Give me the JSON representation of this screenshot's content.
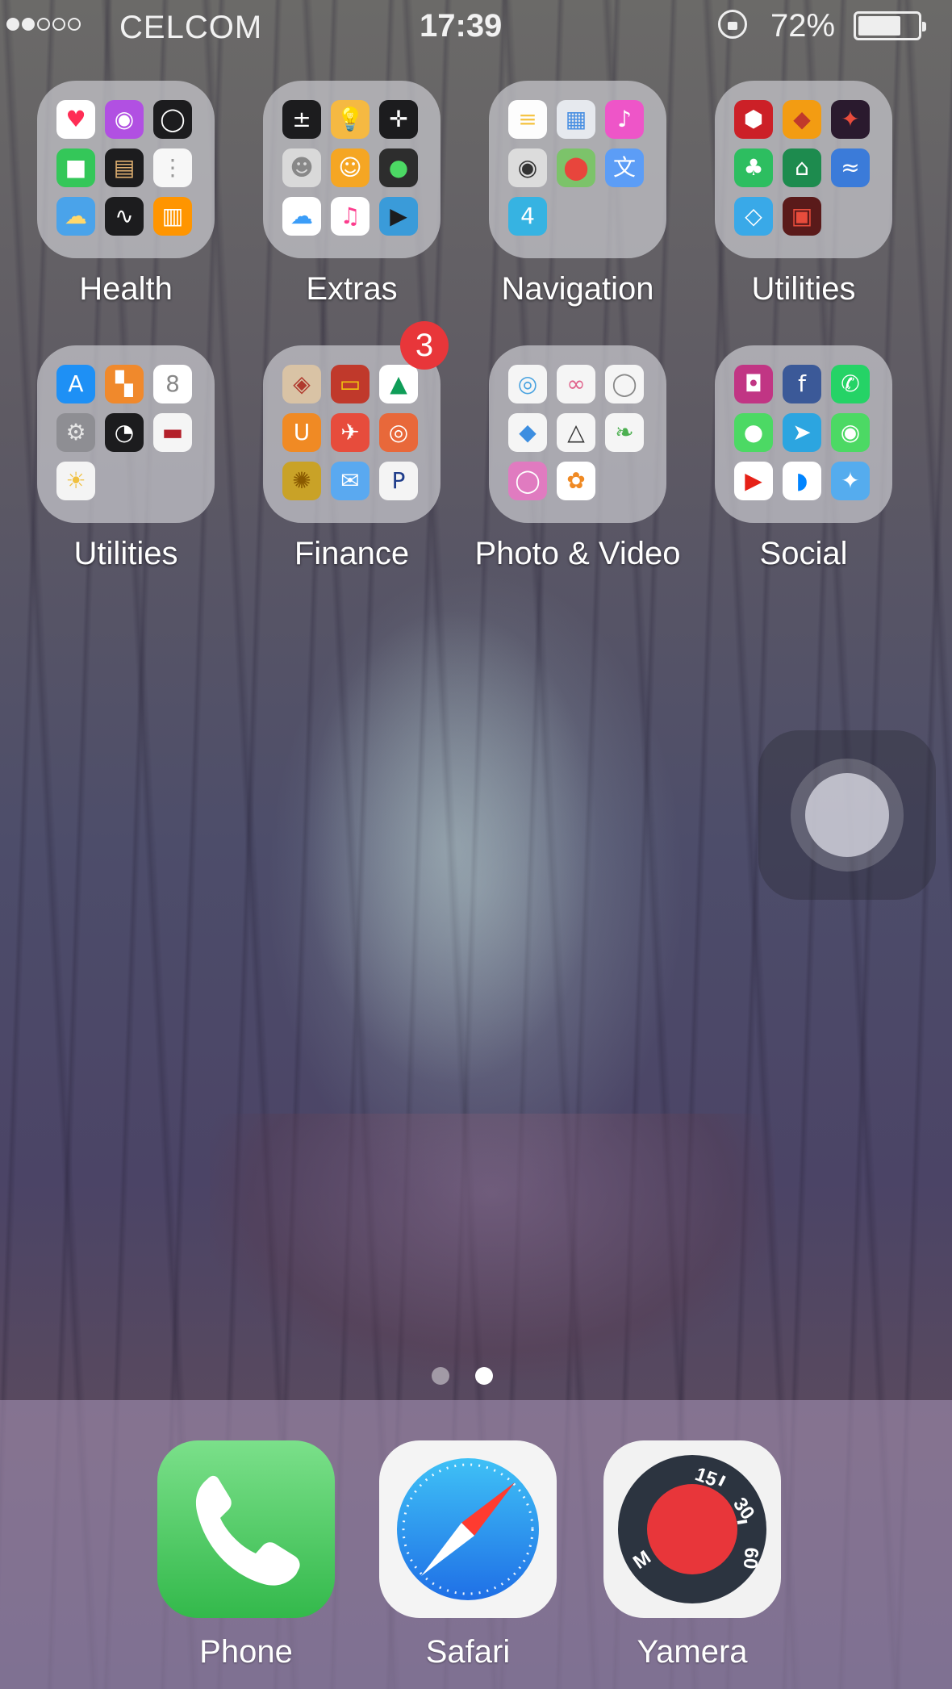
{
  "status_bar": {
    "carrier": "CELCOM",
    "time": "17:39",
    "battery_percent": "72%",
    "signal_bars": 2,
    "signal_total": 5,
    "battery_level": 0.72
  },
  "folders": [
    {
      "label": "Health",
      "apps": [
        {
          "icon": "health-icon",
          "color": "#ffffff",
          "glyph": "♥",
          "glyph_color": "#ff2d55"
        },
        {
          "icon": "podcasts-icon",
          "color": "#b150e2",
          "glyph": "◉",
          "glyph_color": "#ffffff"
        },
        {
          "icon": "watch-icon",
          "color": "#1c1c1e",
          "glyph": "◯",
          "glyph_color": "#ffffff"
        },
        {
          "icon": "facetime-icon",
          "color": "#34c759",
          "glyph": "■",
          "glyph_color": "#ffffff"
        },
        {
          "icon": "wallet-icon",
          "color": "#1c1c1e",
          "glyph": "▤",
          "glyph_color": "#e0b070"
        },
        {
          "icon": "reminders-icon",
          "color": "#f7f7f7",
          "glyph": "⋮",
          "glyph_color": "#999999"
        },
        {
          "icon": "weather-icon",
          "color": "#4aa3ea",
          "glyph": "☁",
          "glyph_color": "#ffd86b"
        },
        {
          "icon": "stocks-icon",
          "color": "#1c1c1e",
          "glyph": "∿",
          "glyph_color": "#ffffff"
        },
        {
          "icon": "ibooks-icon",
          "color": "#ff9500",
          "glyph": "▥",
          "glyph_color": "#ffffff"
        }
      ]
    },
    {
      "label": "Extras",
      "apps": [
        {
          "icon": "calculator-icon",
          "color": "#1c1c1e",
          "glyph": "±",
          "glyph_color": "#ffffff"
        },
        {
          "icon": "tips-icon",
          "color": "#f5b942",
          "glyph": "💡",
          "glyph_color": "#ffffff"
        },
        {
          "icon": "compass-icon",
          "color": "#1c1c1e",
          "glyph": "✛",
          "glyph_color": "#ffffff"
        },
        {
          "icon": "contacts-icon",
          "color": "#d9d9d9",
          "glyph": "☻",
          "glyph_color": "#888888"
        },
        {
          "icon": "find-friends-icon",
          "color": "#f5a623",
          "glyph": "☺",
          "glyph_color": "#ffffff"
        },
        {
          "icon": "find-iphone-icon",
          "color": "#2d2d2d",
          "glyph": "●",
          "glyph_color": "#4cd964"
        },
        {
          "icon": "icloud-drive-icon",
          "color": "#ffffff",
          "glyph": "☁",
          "glyph_color": "#3b9df8"
        },
        {
          "icon": "itunes-store-icon",
          "color": "#ffffff",
          "glyph": "♫",
          "glyph_color": "#fc3c8d"
        },
        {
          "icon": "videos-icon",
          "color": "#3a9bd9",
          "glyph": "▶",
          "glyph_color": "#1c1c1e"
        }
      ]
    },
    {
      "label": "Navigation",
      "apps": [
        {
          "icon": "notes-icon",
          "color": "#fdfdfd",
          "glyph": "≡",
          "glyph_color": "#f5c445"
        },
        {
          "icon": "preview-icon",
          "color": "#e6e9ee",
          "glyph": "▦",
          "glyph_color": "#4a90e2"
        },
        {
          "icon": "itunes-icon",
          "color": "#ee55c8",
          "glyph": "♪",
          "glyph_color": "#ffffff"
        },
        {
          "icon": "camera-icon",
          "color": "#dcdcdc",
          "glyph": "◉",
          "glyph_color": "#333333"
        },
        {
          "icon": "google-maps-icon",
          "color": "#7cc36a",
          "glyph": "⬤",
          "glyph_color": "#e8453c"
        },
        {
          "icon": "translate-icon",
          "color": "#5c9df6",
          "glyph": "文",
          "glyph_color": "#ffffff"
        },
        {
          "icon": "foursquare-icon",
          "color": "#36b3e2",
          "glyph": "4",
          "glyph_color": "#ffffff"
        }
      ]
    },
    {
      "label": "Utilities",
      "apps": [
        {
          "icon": "lastpass-icon",
          "color": "#cc2027",
          "glyph": "⬢",
          "glyph_color": "#ffffff"
        },
        {
          "icon": "game-icon",
          "color": "#f39c12",
          "glyph": "◆",
          "glyph_color": "#c0392b"
        },
        {
          "icon": "dark-app-icon",
          "color": "#2a1a2e",
          "glyph": "✦",
          "glyph_color": "#e74c3c"
        },
        {
          "icon": "evernote-icon",
          "color": "#2dbe60",
          "glyph": "♣",
          "glyph_color": "#ffffff"
        },
        {
          "icon": "mosque-icon",
          "color": "#1d8b4e",
          "glyph": "⌂",
          "glyph_color": "#ffffff"
        },
        {
          "icon": "wave-icon",
          "color": "#3b7bd9",
          "glyph": "≈",
          "glyph_color": "#ffffff"
        },
        {
          "icon": "diamond-app-icon",
          "color": "#39a9e8",
          "glyph": "◇",
          "glyph_color": "#ffffff"
        },
        {
          "icon": "marvel-icon",
          "color": "#5a1a1a",
          "glyph": "▣",
          "glyph_color": "#e74c3c"
        }
      ]
    },
    {
      "label": "Utilities",
      "apps": [
        {
          "icon": "app-store-icon",
          "color": "#1e90f5",
          "glyph": "A",
          "glyph_color": "#ffffff"
        },
        {
          "icon": "office-icon",
          "color": "#f0892c",
          "glyph": "▚",
          "glyph_color": "#ffffff"
        },
        {
          "icon": "calendar-icon",
          "color": "#ffffff",
          "glyph": "8",
          "glyph_color": "#888888"
        },
        {
          "icon": "settings-icon",
          "color": "#8e8e93",
          "glyph": "⚙",
          "glyph_color": "#e5e5e5"
        },
        {
          "icon": "clock-icon",
          "color": "#1c1c1e",
          "glyph": "◔",
          "glyph_color": "#ffffff"
        },
        {
          "icon": "bank-card-icon",
          "color": "#f5f5f5",
          "glyph": "▬",
          "glyph_color": "#b3202a"
        },
        {
          "icon": "sun-app-icon",
          "color": "#f4f4f4",
          "glyph": "☀",
          "glyph_color": "#f0c040"
        }
      ]
    },
    {
      "label": "Finance",
      "badge": "3",
      "apps": [
        {
          "icon": "shield-app-icon",
          "color": "#d9c3a5",
          "glyph": "◈",
          "glyph_color": "#b03a2e"
        },
        {
          "icon": "card-app-icon",
          "color": "#c0392b",
          "glyph": "▭",
          "glyph_color": "#f1c40f"
        },
        {
          "icon": "google-drive-icon",
          "color": "#ffffff",
          "glyph": "▲",
          "glyph_color": "#0f9d58"
        },
        {
          "icon": "u-app-icon",
          "color": "#f08a24",
          "glyph": "U",
          "glyph_color": "#ffffff"
        },
        {
          "icon": "boost-icon",
          "color": "#e74c3c",
          "glyph": "✈",
          "glyph_color": "#ffffff"
        },
        {
          "icon": "orange-app-icon",
          "color": "#e8683a",
          "glyph": "◎",
          "glyph_color": "#ffffff"
        },
        {
          "icon": "gold-app-icon",
          "color": "#c9a227",
          "glyph": "✺",
          "glyph_color": "#8a5a00"
        },
        {
          "icon": "mail-app-icon",
          "color": "#5aa9f0",
          "glyph": "✉",
          "glyph_color": "#ffffff"
        },
        {
          "icon": "paypal-icon",
          "color": "#f4f4f4",
          "glyph": "P",
          "glyph_color": "#1f3d8b"
        }
      ]
    },
    {
      "label": "Photo & Video",
      "apps": [
        {
          "icon": "swirl-app-icon",
          "color": "#f5f5f5",
          "glyph": "◎",
          "glyph_color": "#4aa3e0"
        },
        {
          "icon": "infinity-app-icon",
          "color": "#f5f5f5",
          "glyph": "∞",
          "glyph_color": "#e0608a"
        },
        {
          "icon": "ring-app-icon",
          "color": "#f5f5f5",
          "glyph": "◯",
          "glyph_color": "#888888"
        },
        {
          "icon": "dropbox-icon",
          "color": "#f5f5f5",
          "glyph": "◆",
          "glyph_color": "#3d8ee0"
        },
        {
          "icon": "triangle-app-icon",
          "color": "#f5f5f5",
          "glyph": "△",
          "glyph_color": "#333333"
        },
        {
          "icon": "leaf-app-icon",
          "color": "#f5f5f5",
          "glyph": "❧",
          "glyph_color": "#4caf50"
        },
        {
          "icon": "gradient-app-icon",
          "color": "#e07bc0",
          "glyph": "◯",
          "glyph_color": "#ffffff"
        },
        {
          "icon": "photos-icon",
          "color": "#ffffff",
          "glyph": "✿",
          "glyph_color": "#f08a24"
        }
      ]
    },
    {
      "label": "Social",
      "apps": [
        {
          "icon": "instagram-icon",
          "color": "#c13584",
          "glyph": "◘",
          "glyph_color": "#ffffff"
        },
        {
          "icon": "facebook-icon",
          "color": "#3b5998",
          "glyph": "f",
          "glyph_color": "#ffffff"
        },
        {
          "icon": "whatsapp-icon",
          "color": "#25d366",
          "glyph": "✆",
          "glyph_color": "#ffffff"
        },
        {
          "icon": "messages-icon",
          "color": "#4cd964",
          "glyph": "●",
          "glyph_color": "#ffffff"
        },
        {
          "icon": "telegram-icon",
          "color": "#2ca5e0",
          "glyph": "➤",
          "glyph_color": "#ffffff"
        },
        {
          "icon": "wechat-icon",
          "color": "#4cd964",
          "glyph": "◉",
          "glyph_color": "#ffffff"
        },
        {
          "icon": "youtube-icon",
          "color": "#ffffff",
          "glyph": "▶",
          "glyph_color": "#e62117"
        },
        {
          "icon": "messenger-icon",
          "color": "#ffffff",
          "glyph": "◗",
          "glyph_color": "#0084ff"
        },
        {
          "icon": "twitter-icon",
          "color": "#55acee",
          "glyph": "✦",
          "glyph_color": "#ffffff"
        }
      ]
    }
  ],
  "page_indicator": {
    "total": 2,
    "current": 2
  },
  "dock": [
    {
      "label": "Phone",
      "icon": "phone-icon"
    },
    {
      "label": "Safari",
      "icon": "safari-compass-icon"
    },
    {
      "label": "Yamera",
      "icon": "yamera-dial-icon"
    }
  ],
  "yamera_dial_numbers": [
    "15",
    "30",
    "60",
    "M"
  ],
  "colors": {
    "badge_red": "#e8363a",
    "phone_green": "#33b94b",
    "yamera_record_red": "#e8363a"
  }
}
